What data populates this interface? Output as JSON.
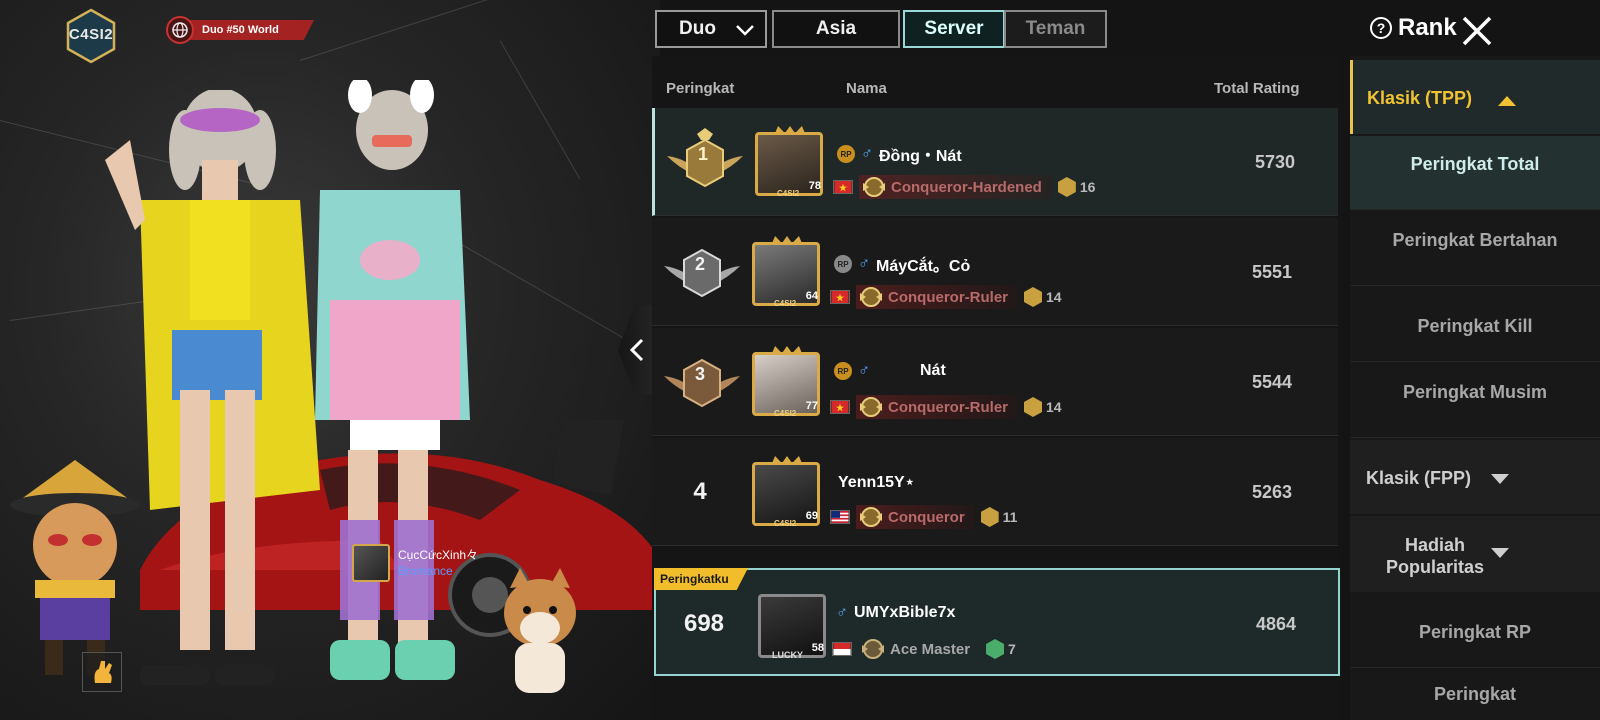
{
  "header": {
    "crew_emblem": "C4SI2",
    "duo_title": "Duo #50 World",
    "mode_dropdown": "Duo",
    "tabs": [
      "Asia",
      "Server",
      "Teman"
    ],
    "active_tab": "Server",
    "rank_title": "Rank",
    "help_icon": "?"
  },
  "columns": {
    "rank": "Peringkat",
    "name": "Nama",
    "rating": "Total Rating"
  },
  "rows": [
    {
      "rank": "1",
      "name": "Đồng・Nát",
      "level": "78",
      "tier": "Conqueror-Hardened",
      "stars": "16",
      "rating": "5730",
      "flag": "VN"
    },
    {
      "rank": "2",
      "name": "MáyCắt。Cỏ",
      "level": "64",
      "tier": "Conqueror-Ruler",
      "stars": "14",
      "rating": "5551",
      "flag": "VN"
    },
    {
      "rank": "3",
      "name": "Nát",
      "level": "77",
      "tier": "Conqueror-Ruler",
      "stars": "14",
      "rating": "5544",
      "flag": "VN"
    },
    {
      "rank": "4",
      "name": "Yenn15Y⋆",
      "level": "69",
      "tier": "Conqueror",
      "stars": "11",
      "rating": "5263",
      "flag": "MY"
    }
  ],
  "my_rank": {
    "label": "Peringkatku",
    "rank": "698",
    "name": "UMYxBible7x",
    "level": "58",
    "avatar_tag": "LUCKY",
    "tier": "Ace Master",
    "stars": "7",
    "rating": "4864"
  },
  "avatar_badge": "C4SI2",
  "player_tag": {
    "name": "CụcCứcXinh々",
    "bond": "Bromance"
  },
  "menu": {
    "category_open": "Klasik (TPP)",
    "items": [
      "Peringkat Total",
      "Peringkat Bertahan",
      "Peringkat Kill",
      "Peringkat Musim"
    ],
    "category_fpp": "Klasik (FPP)",
    "category_popularity": "Hadiah Popularitas",
    "item_rp": "Peringkat RP",
    "item_last": "Peringkat"
  },
  "colors": {
    "accent_teal": "#9ad9d6",
    "tier_red": "#b86a6a",
    "gold": "#d9aa45",
    "my_label_yellow": "#f1bd2a"
  }
}
